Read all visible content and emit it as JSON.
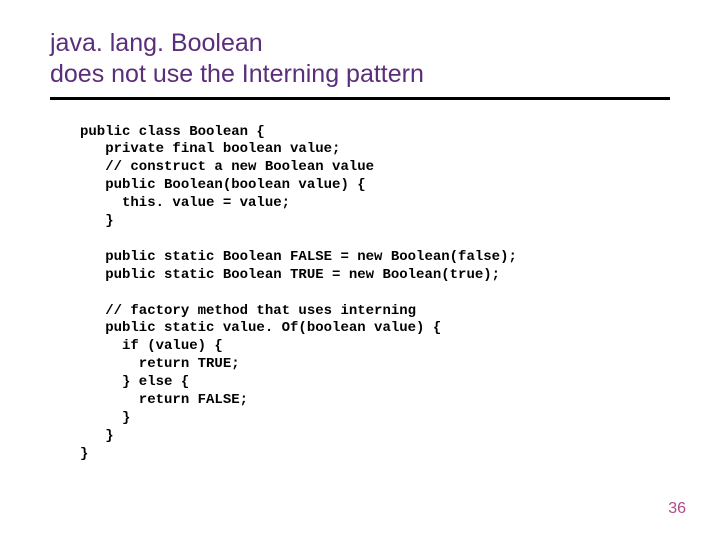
{
  "title_line1": "java. lang. Boolean",
  "title_line2": "does not use the Interning pattern",
  "code": "public class Boolean {\n   private final boolean value;\n   // construct a new Boolean value\n   public Boolean(boolean value) {\n     this. value = value;\n   }\n\n   public static Boolean FALSE = new Boolean(false);\n   public static Boolean TRUE = new Boolean(true);\n\n   // factory method that uses interning\n   public static value. Of(boolean value) {\n     if (value) {\n       return TRUE;\n     } else {\n       return FALSE;\n     }\n   }\n}",
  "page_number": "36"
}
